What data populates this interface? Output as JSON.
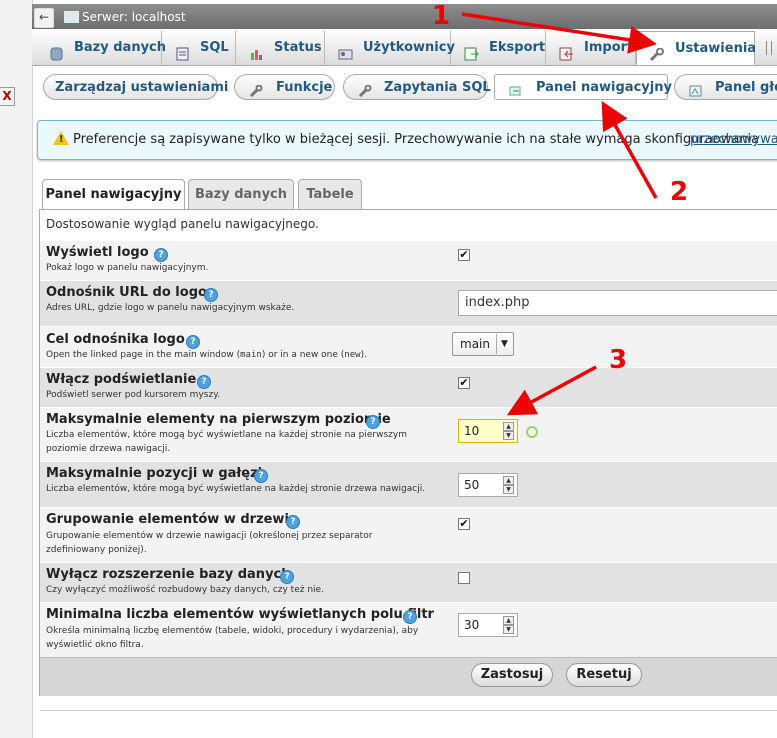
{
  "left_pane": {
    "close_label": "X"
  },
  "server_bar": {
    "back_symbol": "←",
    "title": "Serwer: localhost"
  },
  "top_tabs": [
    {
      "label": "Bazy danych",
      "icon": "database-icon"
    },
    {
      "label": "SQL",
      "icon": "sql-icon"
    },
    {
      "label": "Status",
      "icon": "status-chart-icon"
    },
    {
      "label": "Użytkownicy",
      "icon": "users-icon"
    },
    {
      "label": "Eksport",
      "icon": "export-icon"
    },
    {
      "label": "Import",
      "icon": "import-icon"
    },
    {
      "label": "Ustawienia",
      "icon": "wrench-icon",
      "active": true
    }
  ],
  "sub_tabs": [
    {
      "label": "Zarządzaj ustawieniami"
    },
    {
      "label": "Funkcje",
      "icon": "wrench-icon"
    },
    {
      "label": "Zapytania SQL",
      "icon": "sql-icon"
    },
    {
      "label": "Panel nawigacyjny",
      "icon": "navigation-icon",
      "active": true
    },
    {
      "label": "Panel głó",
      "icon": "main-panel-icon"
    }
  ],
  "notice": {
    "text": "Preferencje są zapisywane tylko w bieżącej sesji. Przechowywanie ich na stałe wymaga skonfiguraowania",
    "link": "przechowywani"
  },
  "form_tabs": [
    {
      "label": "Panel nawigacyjny",
      "active": true
    },
    {
      "label": "Bazy danych"
    },
    {
      "label": "Tabele"
    }
  ],
  "panel_description": "Dostosowanie wygląd panelu nawigacyjnego.",
  "settings": {
    "show_logo": {
      "label": "Wyświetl logo",
      "desc": "Pokaż logo w panelu nawigacyjnym.",
      "checked": true
    },
    "logo_link": {
      "label": "Odnośnik URL do logo",
      "desc": "Adres URL, gdzie logo w panelu nawigacyjnym wskaże.",
      "value": "index.php"
    },
    "logo_target": {
      "label": "Cel odnośnika logo",
      "desc_prefix": "Open the linked page in the main window (",
      "desc_code1": "main",
      "desc_mid": ") or in a new one (",
      "desc_code2": "new",
      "desc_suffix": ").",
      "value": "main"
    },
    "highlight": {
      "label": "Włącz podświetlanie",
      "desc": "Podświetl serwer pod kursorem myszy.",
      "checked": true
    },
    "first_level_max": {
      "label": "Maksymalnie elementy na pierwszym poziomie",
      "desc": "Liczba elementów, które mogą być wyświetlane na każdej stronie na pierwszym poziomie drzewa nawigacji.",
      "value": "10"
    },
    "branch_max": {
      "label": "Maksymalnie pozycji w gałęzi",
      "desc": "Liczba elementów, które mogą być wyświetlane na każdej stronie drzewa nawigacji.",
      "value": "50"
    },
    "tree_grouping": {
      "label": "Grupowanie elementów w drzewie",
      "desc": "Grupowanie elementów w drzewie nawigacji (określonej przez separator zdefiniowany poniżej).",
      "checked": true
    },
    "db_expand": {
      "label": "Wyłącz rozszerzenie bazy danych",
      "desc": "Czy wyłączyć możliwość rozbudowy bazy danych, czy też nie.",
      "checked": false
    },
    "min_filter": {
      "label": "Minimalna liczba elementów wyświetlanych polu filtr",
      "desc": "Określa minimalną liczbę elementów (tabele, widoki, procedury i wydarzenia), aby wyświetlić okno filtra.",
      "value": "30"
    }
  },
  "buttons": {
    "apply": "Zastosuj",
    "reset": "Resetuj"
  },
  "annotations": [
    "1",
    "2",
    "3"
  ],
  "colors": {
    "link": "#235a81",
    "annotation": "#e00000",
    "notice_bg": "#ebf8fd"
  }
}
